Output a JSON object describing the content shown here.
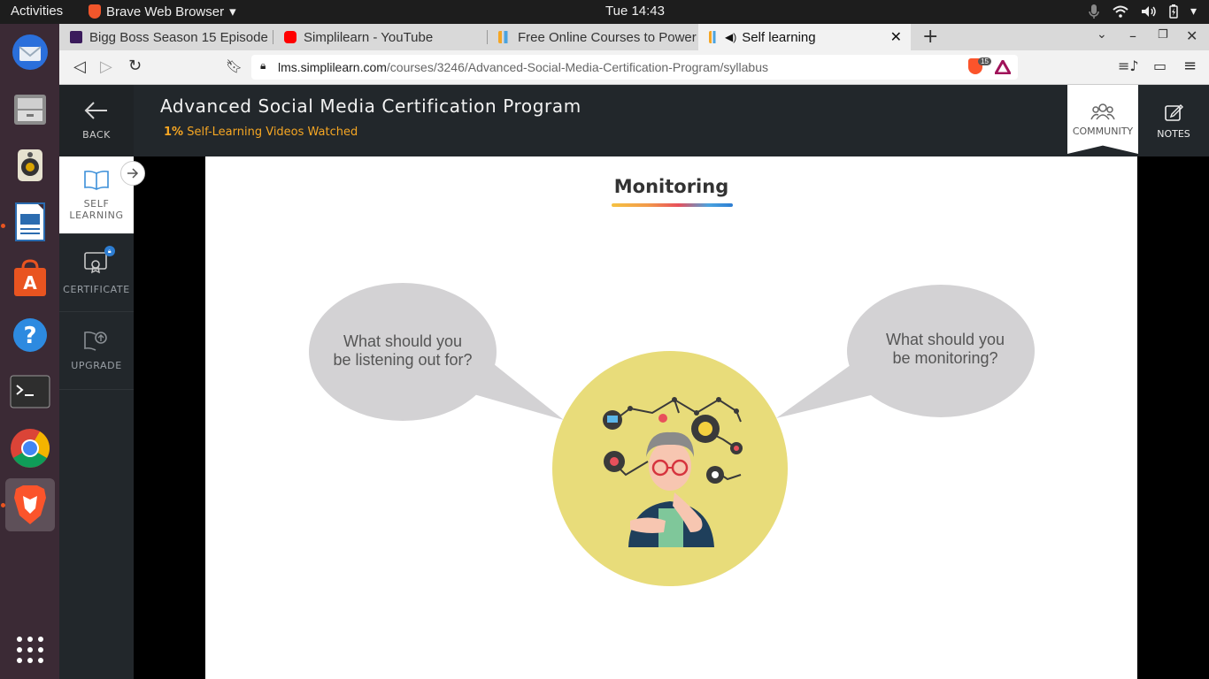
{
  "system": {
    "activities": "Activities",
    "app_name": "Brave Web Browser",
    "clock": "Tue 14:43"
  },
  "tabs": [
    {
      "label": "Bigg Boss Season 15 Episode",
      "favicon": "voot-icon"
    },
    {
      "label": "Simplilearn - YouTube",
      "favicon": "youtube-icon"
    },
    {
      "label": "Free Online Courses to Power",
      "favicon": "simplilearn-icon"
    },
    {
      "label": "Self learning",
      "favicon": "simplilearn-icon",
      "active": true
    }
  ],
  "address": {
    "domain": "lms.simplilearn.com",
    "path": "/courses/3246/Advanced-Social-Media-Certification-Program/syllabus",
    "shields_count": "15"
  },
  "header": {
    "back_label": "BACK",
    "course_title": "Advanced Social Media Certification Program",
    "progress_percent": "1%",
    "progress_label": "Self-Learning Videos Watched",
    "community_label": "COMMUNITY",
    "notes_label": "NOTES"
  },
  "rail": {
    "self_learning_line1": "SELF",
    "self_learning_line2": "LEARNING",
    "certificate": "CERTIFICATE",
    "upgrade": "UPGRADE"
  },
  "slide": {
    "title": "Monitoring",
    "left_bubble_line1": "What should you",
    "left_bubble_line2": "be listening out for?",
    "right_bubble_line1": "What should you",
    "right_bubble_line2": "be monitoring?"
  },
  "colors": {
    "accent_orange": "#f5a623",
    "header_dark": "#22272b",
    "bubble_grey": "#d3d2d4",
    "circle_yellow": "#e8dc7a"
  }
}
